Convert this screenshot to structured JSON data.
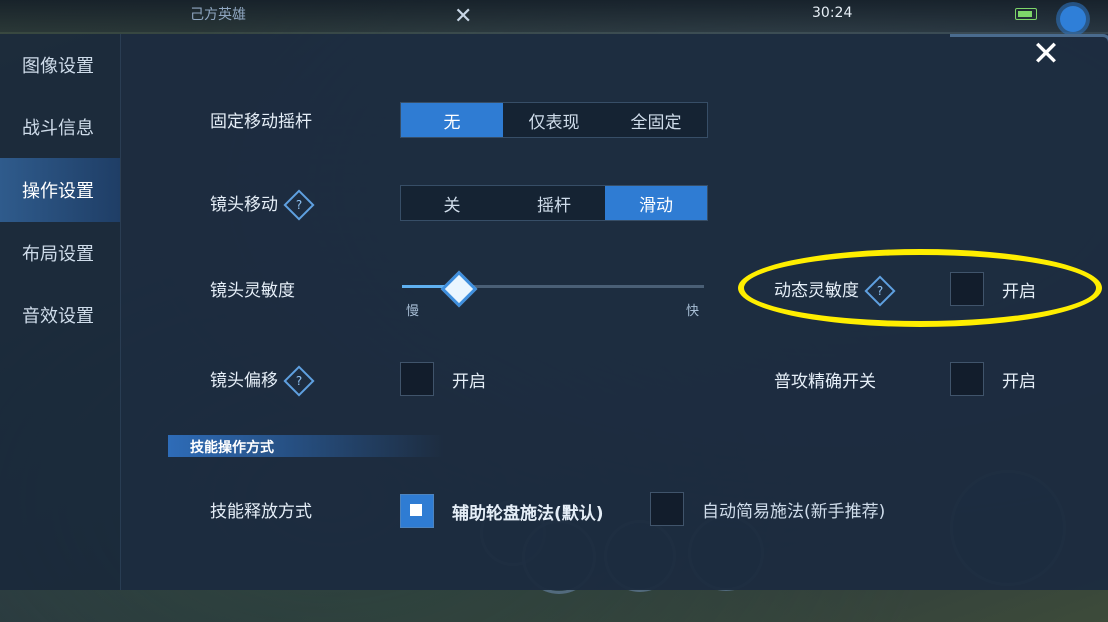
{
  "hud": {
    "team_label": "己方英雄",
    "clock": "30:24"
  },
  "sidebar": {
    "items": [
      {
        "label": "图像设置",
        "active": false
      },
      {
        "label": "战斗信息",
        "active": false
      },
      {
        "label": "操作设置",
        "active": true
      },
      {
        "label": "布局设置",
        "active": false
      },
      {
        "label": "音效设置",
        "active": false
      }
    ]
  },
  "settings": {
    "joystick": {
      "label": "固定移动摇杆",
      "options": [
        "无",
        "仅表现",
        "全固定"
      ],
      "selected": "无"
    },
    "camera_move": {
      "label": "镜头移动",
      "options": [
        "关",
        "摇杆",
        "滑动"
      ],
      "selected": "滑动"
    },
    "camera_sensitivity": {
      "label": "镜头灵敏度",
      "min_label": "慢",
      "max_label": "快",
      "value_fraction": 0.18
    },
    "dynamic_sensitivity": {
      "label": "动态灵敏度",
      "toggle_label": "开启",
      "checked": false
    },
    "camera_offset": {
      "label": "镜头偏移",
      "toggle_label": "开启",
      "checked": false
    },
    "basic_attack_precise": {
      "label": "普攻精确开关",
      "toggle_label": "开启",
      "checked": false
    },
    "skill_section": {
      "title": "技能操作方式"
    },
    "skill_release": {
      "label": "技能释放方式",
      "option1": "辅助轮盘施法(默认)",
      "option1_checked": true,
      "option2": "自动简易施法(新手推荐)",
      "option2_checked": false
    }
  },
  "colors": {
    "accent": "#2f7cd3",
    "highlight": "#ffee00"
  }
}
